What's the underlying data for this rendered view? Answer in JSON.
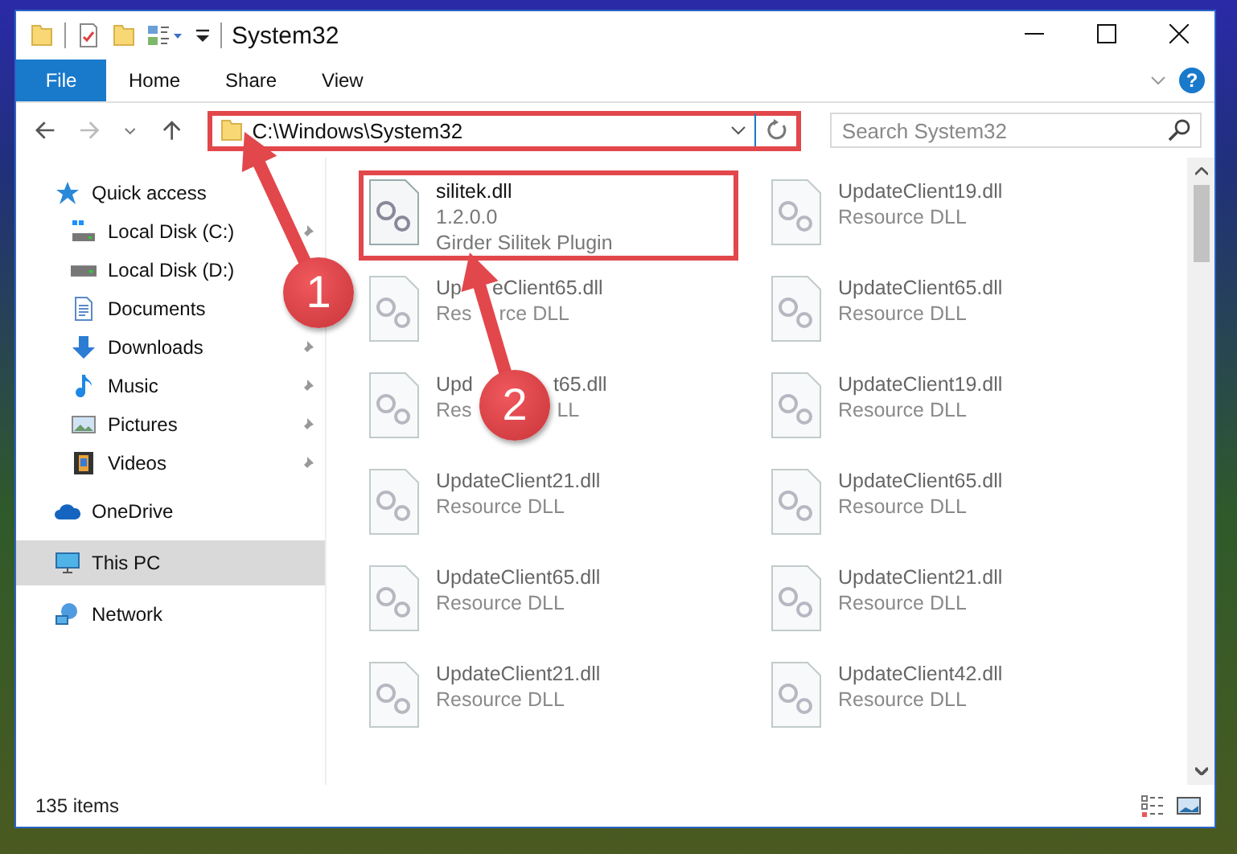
{
  "window": {
    "title": "System32"
  },
  "ribbon_tabs": [
    {
      "label": "File",
      "selected": true
    },
    {
      "label": "Home",
      "selected": false
    },
    {
      "label": "Share",
      "selected": false
    },
    {
      "label": "View",
      "selected": false
    }
  ],
  "help": "?",
  "address": {
    "path": "C:\\Windows\\System32",
    "highlighted": true
  },
  "search": {
    "placeholder": "Search System32"
  },
  "sidebar": {
    "items": [
      {
        "label": "Quick access",
        "kind": "star",
        "selected": false,
        "children": [
          {
            "label": "Local Disk (C:)",
            "kind": "system-drive",
            "pinned": true,
            "selected": false
          },
          {
            "label": "Local Disk (D:)",
            "kind": "drive",
            "pinned": false,
            "selected": false
          },
          {
            "label": "Documents",
            "kind": "documents",
            "pinned": false,
            "selected": false
          },
          {
            "label": "Downloads",
            "kind": "downloads",
            "pinned": true,
            "selected": false
          },
          {
            "label": "Music",
            "kind": "music",
            "pinned": true,
            "selected": false
          },
          {
            "label": "Pictures",
            "kind": "pictures",
            "pinned": true,
            "selected": false
          },
          {
            "label": "Videos",
            "kind": "videos",
            "pinned": true,
            "selected": false
          }
        ]
      },
      {
        "label": "OneDrive",
        "kind": "cloud",
        "selected": false
      },
      {
        "label": "This PC",
        "kind": "pc",
        "selected": true
      },
      {
        "label": "Network",
        "kind": "network",
        "selected": false
      }
    ]
  },
  "files": [
    {
      "name": "silitek.dll",
      "details": [
        "1.2.0.0",
        "Girder Silitek Plugin"
      ],
      "blurred": false,
      "highlighted": true
    },
    {
      "name": "UpdateClient19.dll",
      "details": [
        "Resource DLL"
      ],
      "blurred": true,
      "highlighted": false
    },
    {
      "name_parts": [
        "Up",
        "eClient65.dll"
      ],
      "detail_parts": [
        [
          "Res",
          "rce DLL"
        ]
      ],
      "blurred": true,
      "highlighted": false
    },
    {
      "name": "UpdateClient65.dll",
      "details": [
        "Resource DLL"
      ],
      "blurred": true,
      "highlighted": false
    },
    {
      "name_parts": [
        "Upd",
        "t65.dll"
      ],
      "detail_parts": [
        [
          "Res",
          "LL"
        ]
      ],
      "blurred": true,
      "highlighted": false
    },
    {
      "name": "UpdateClient19.dll",
      "details": [
        "Resource DLL"
      ],
      "blurred": true,
      "highlighted": false
    },
    {
      "name": "UpdateClient21.dll",
      "details": [
        "Resource DLL"
      ],
      "blurred": true,
      "highlighted": false
    },
    {
      "name": "UpdateClient65.dll",
      "details": [
        "Resource DLL"
      ],
      "blurred": true,
      "highlighted": false
    },
    {
      "name": "UpdateClient65.dll",
      "details": [
        "Resource DLL"
      ],
      "blurred": true,
      "highlighted": false
    },
    {
      "name": "UpdateClient21.dll",
      "details": [
        "Resource DLL"
      ],
      "blurred": true,
      "highlighted": false
    },
    {
      "name": "UpdateClient21.dll",
      "details": [
        "Resource DLL"
      ],
      "blurred": true,
      "highlighted": false
    },
    {
      "name": "UpdateClient42.dll",
      "details": [
        "Resource DLL"
      ],
      "blurred": true,
      "highlighted": false
    }
  ],
  "status_bar": {
    "item_count": "135 items"
  },
  "annotations": [
    {
      "label": "1"
    },
    {
      "label": "2"
    }
  ]
}
